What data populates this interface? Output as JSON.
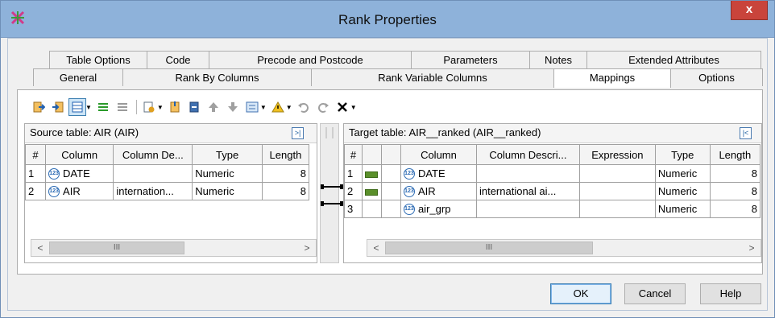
{
  "window": {
    "title": "Rank Properties",
    "close_label": "x"
  },
  "tabs_row1": [
    "Table Options",
    "Code",
    "Precode and Postcode",
    "Parameters",
    "Notes",
    "Extended Attributes"
  ],
  "tabs_row2": [
    "General",
    "Rank By Columns",
    "Rank Variable Columns",
    "Mappings",
    "Options"
  ],
  "active_tab": "Mappings",
  "source": {
    "title": "Source table: AIR (AIR)",
    "collapse_icon": ">|",
    "columns": [
      "#",
      "Column",
      "Column De...",
      "Type",
      "Length"
    ],
    "rows": [
      {
        "num": "1",
        "column": "DATE",
        "description": "",
        "type": "Numeric",
        "length": "8"
      },
      {
        "num": "2",
        "column": "AIR",
        "description": "internation...",
        "type": "Numeric",
        "length": "8"
      }
    ],
    "scroll_left": "<",
    "scroll_thumb": "III",
    "scroll_right": ">"
  },
  "target": {
    "title": "Target table: AIR__ranked (AIR__ranked)",
    "collapse_icon": "|<",
    "columns": [
      "#",
      "",
      "",
      "Column",
      "Column Descri...",
      "Expression",
      "Type",
      "Length"
    ],
    "rows": [
      {
        "num": "1",
        "mapped": true,
        "column": "DATE",
        "description": "",
        "expression": "",
        "type": "Numeric",
        "length": "8"
      },
      {
        "num": "2",
        "mapped": true,
        "column": "AIR",
        "description": "international ai...",
        "expression": "",
        "type": "Numeric",
        "length": "8"
      },
      {
        "num": "3",
        "mapped": false,
        "column": "air_grp",
        "description": "",
        "expression": "",
        "type": "Numeric",
        "length": "8"
      }
    ],
    "scroll_left": "<",
    "scroll_thumb": "III",
    "scroll_right": ">"
  },
  "type_icon_text": "123",
  "buttons": {
    "ok": "OK",
    "cancel": "Cancel",
    "help": "Help"
  },
  "colors": {
    "titlebar": "#8eb2da",
    "close": "#c9443b",
    "accent": "#3c7fb1"
  }
}
